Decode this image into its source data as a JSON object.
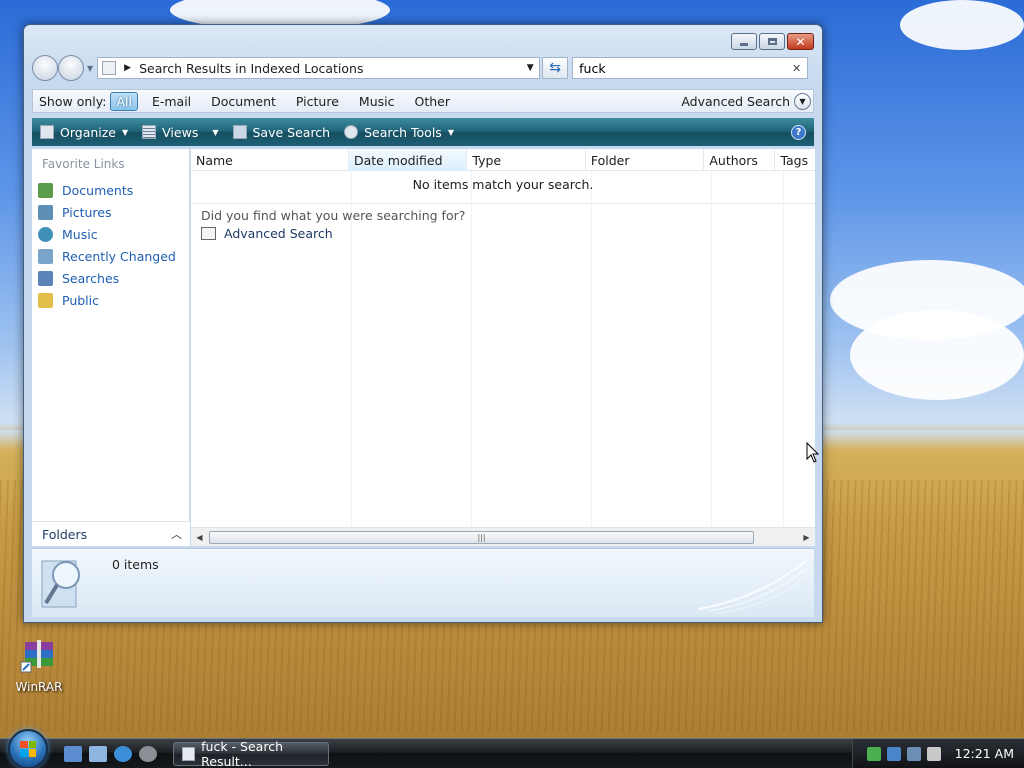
{
  "window": {
    "address": "Search Results in Indexed Locations",
    "search_value": "fuck"
  },
  "show_only": {
    "label": "Show only:",
    "filters": [
      "All",
      "E-mail",
      "Document",
      "Picture",
      "Music",
      "Other"
    ],
    "active": "All",
    "advanced_search": "Advanced Search"
  },
  "toolbar": {
    "organize": "Organize",
    "views": "Views",
    "save_search": "Save Search",
    "search_tools": "Search Tools",
    "help": "?"
  },
  "sidebar": {
    "title": "Favorite Links",
    "items": [
      {
        "label": "Documents",
        "icon": "documents-icon",
        "color": "#5b9c4a"
      },
      {
        "label": "Pictures",
        "icon": "pictures-icon",
        "color": "#5e8fb5"
      },
      {
        "label": "Music",
        "icon": "music-icon",
        "color": "#3f8fb9"
      },
      {
        "label": "Recently Changed",
        "icon": "recently-changed-icon",
        "color": "#7aa4c9"
      },
      {
        "label": "Searches",
        "icon": "searches-icon",
        "color": "#5b85b8"
      },
      {
        "label": "Public",
        "icon": "folder-icon",
        "color": "#e2be4a"
      }
    ],
    "folders_label": "Folders"
  },
  "columns": [
    "Name",
    "Date modified",
    "Type",
    "Folder",
    "Authors",
    "Tags"
  ],
  "content": {
    "empty_message": "No items match your search.",
    "did_you_find": "Did you find what you were searching for?",
    "advanced_search_link": "Advanced Search"
  },
  "details": {
    "count": "0 items"
  },
  "desktop": {
    "winrar_label": "WinRAR"
  },
  "taskbar": {
    "task_label": "fuck - Search Result...",
    "clock": "12:21 AM"
  },
  "colors": {
    "toolbar_accent": "#1f6278",
    "link_blue": "#1e5fb2",
    "filter_active": "#8cc4ea"
  }
}
